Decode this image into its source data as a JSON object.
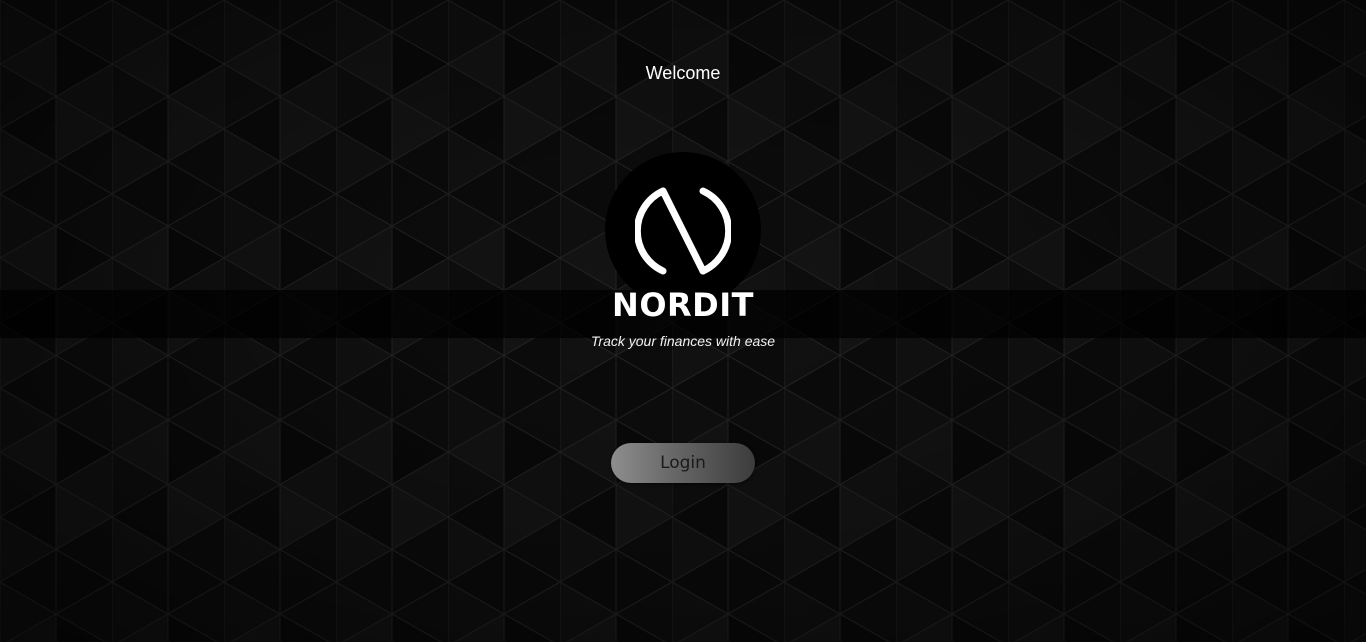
{
  "header": {
    "welcome_text": "Welcome"
  },
  "brand": {
    "logo_icon": "nordit-logo-icon",
    "name": "NORDIT",
    "tagline": "Track your finances with ease"
  },
  "actions": {
    "login_label": "Login"
  },
  "colors": {
    "background": "#070707",
    "text": "#ffffff",
    "button_gradient_start": "#8e8e8e",
    "button_gradient_end": "#3c3c3c"
  }
}
